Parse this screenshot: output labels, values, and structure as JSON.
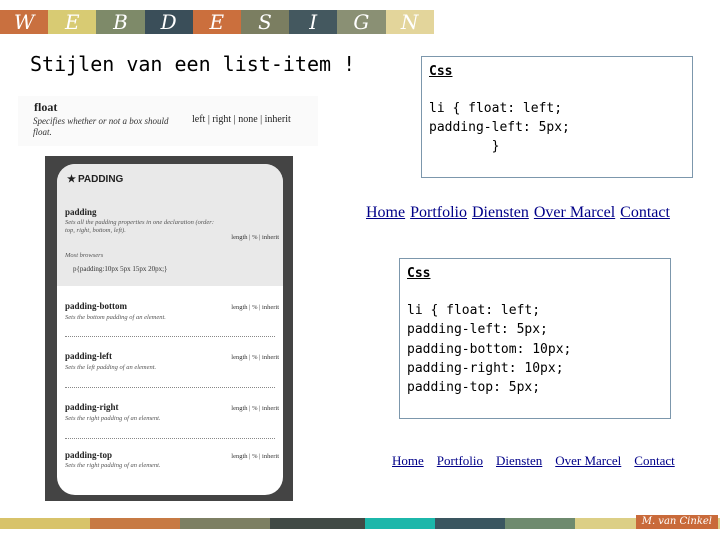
{
  "banner": {
    "letters": [
      "W",
      "E",
      "B",
      "D",
      "E",
      "S",
      "I",
      "G",
      "N"
    ],
    "colors": [
      "#c9703f",
      "#d8cb73",
      "#7e8a69",
      "#3a4e59",
      "#cb6f3d",
      "#7b7e61",
      "#44585f",
      "#8a9074",
      "#e3d59b"
    ]
  },
  "title": "Stijlen van een list-item !",
  "float_ref": {
    "name": "float",
    "description": "Specifies whether or not a box should float.",
    "values": "left | right | none | inherit"
  },
  "padding_ref": {
    "heading": "PADDING",
    "heading_icon": "star-icon",
    "properties": [
      {
        "name": "padding",
        "description": "Sets all the padding properties in one declaration (order: top, right, bottom, left).",
        "values": "length | % | inherit"
      },
      {
        "name": "padding-bottom",
        "description": "Sets the bottom padding of an element.",
        "values": "length | % | inherit"
      },
      {
        "name": "padding-left",
        "description": "Sets the left padding of an element.",
        "values": "length | % | inherit"
      },
      {
        "name": "padding-right",
        "description": "Sets the right padding of an element.",
        "values": "length | % | inherit"
      },
      {
        "name": "padding-top",
        "description": "Sets the right padding of an element.",
        "values": "length | % | inherit"
      }
    ],
    "example_label": "Most browsers",
    "example_code": "p{padding:10px 5px 15px 20px;}"
  },
  "code_box_1": {
    "label": "Css",
    "lines": [
      "li { float: left;",
      "padding-left: 5px;",
      "        }"
    ]
  },
  "code_box_2": {
    "label": "Css",
    "lines": [
      "li { float: left;",
      "padding-left: 5px;",
      "padding-bottom: 10px;",
      "padding-right: 10px;",
      "padding-top: 5px;"
    ]
  },
  "nav_demo_1": [
    "Home",
    "Portfolio",
    "Diensten",
    "Over Marcel",
    "Contact"
  ],
  "nav_demo_2": [
    "Home",
    "Portfolio",
    "Diensten",
    "Over Marcel",
    "Contact"
  ],
  "footer": {
    "author": "M. van Cinkel",
    "bar_colors": [
      "#d8c36a",
      "#c77a44",
      "#7d7f63",
      "#414a45",
      "#1cb7aa",
      "#3a5660",
      "#6e8a6e",
      "#dccf86"
    ]
  }
}
